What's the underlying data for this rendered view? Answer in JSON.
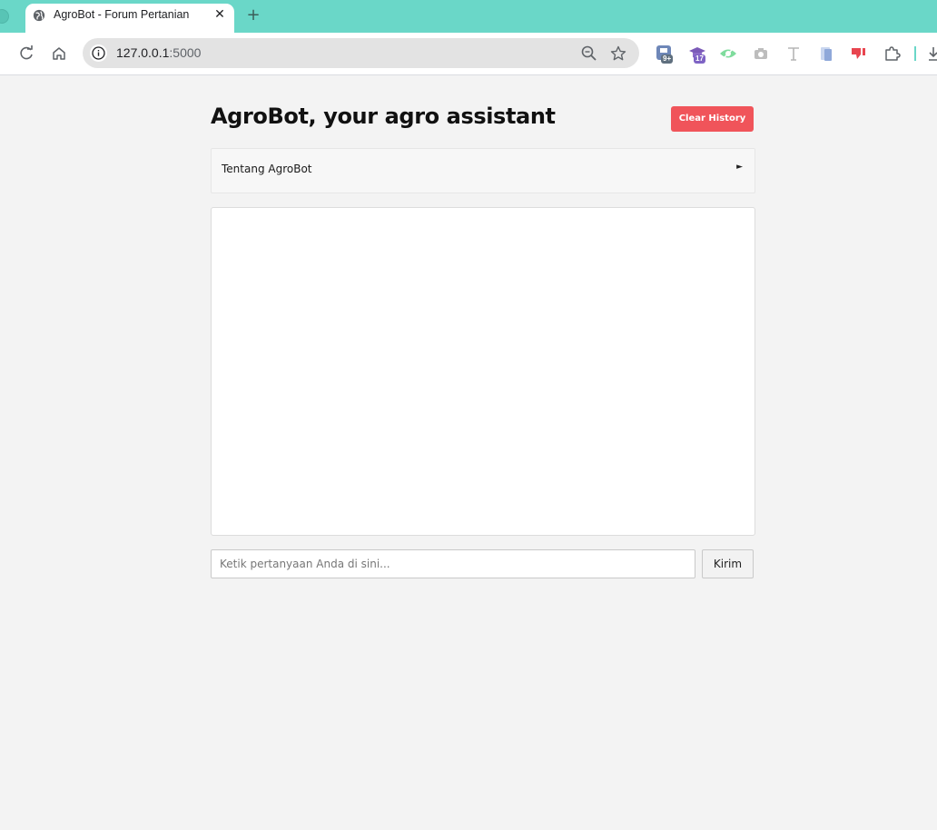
{
  "browser": {
    "tab_title": "AgroBot - Forum Pertanian",
    "url_host": "127.0.0.1",
    "url_port": ":5000",
    "extensions": [
      {
        "name": "extension-save-icon",
        "badge": "9+"
      },
      {
        "name": "extension-graduation-icon",
        "badge": "17"
      },
      {
        "name": "extension-eye-icon",
        "badge": ""
      },
      {
        "name": "extension-camera-icon",
        "badge": ""
      },
      {
        "name": "extension-text-icon",
        "badge": ""
      },
      {
        "name": "extension-copy-icon",
        "badge": ""
      },
      {
        "name": "extension-dislike-icon",
        "badge": ""
      },
      {
        "name": "extensions-puzzle-icon",
        "badge": ""
      }
    ]
  },
  "page": {
    "title": "AgroBot, your agro assistant",
    "clear_label": "Clear History",
    "about_label": "Tentang AgroBot",
    "about_arrow": "►",
    "input_placeholder": "Ketik pertanyaan Anda di sini...",
    "send_label": "Kirim"
  },
  "colors": {
    "tabbar": "#6ad7c8",
    "clear_button": "#f0545a",
    "page_background": "#f3f3f3"
  }
}
